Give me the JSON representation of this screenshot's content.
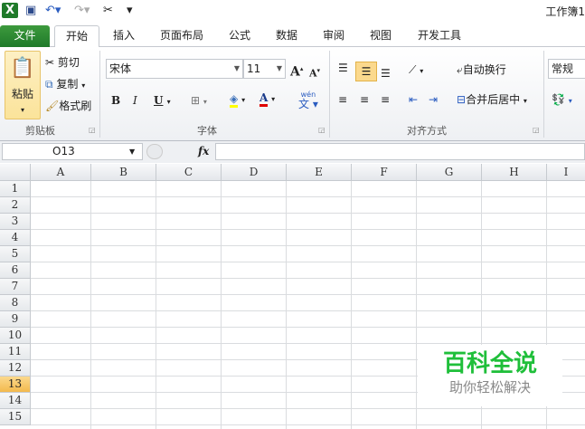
{
  "qat": {
    "app_icon": "excel-icon",
    "save": "save-icon",
    "undo": "undo-icon",
    "redo": "redo-icon",
    "tools": "tools-icon",
    "customize": "customize-qat-icon"
  },
  "title": "工作簿1",
  "tabs": [
    "文件",
    "开始",
    "插入",
    "页面布局",
    "公式",
    "数据",
    "审阅",
    "视图",
    "开发工具"
  ],
  "active_tab": "开始",
  "ribbon": {
    "clipboard": {
      "paste": "粘贴",
      "cut": "剪切",
      "copy": "复制",
      "format_painter": "格式刷",
      "label": "剪贴板"
    },
    "font": {
      "name": "宋体",
      "size": "11",
      "bold": "B",
      "italic": "I",
      "underline": "U",
      "font_color": "A",
      "phonetic": "wén",
      "label": "字体"
    },
    "alignment": {
      "wrap": "自动换行",
      "merge": "合并后居中",
      "label": "对齐方式"
    },
    "number": {
      "format": "常规"
    }
  },
  "formula_bar": {
    "name_box": "O13",
    "fx": "fx",
    "value": ""
  },
  "grid": {
    "columns": [
      "A",
      "B",
      "C",
      "D",
      "E",
      "F",
      "G",
      "H",
      "I"
    ],
    "rows": [
      "1",
      "2",
      "3",
      "4",
      "5",
      "6",
      "7",
      "8",
      "9",
      "10",
      "11",
      "12",
      "13",
      "14",
      "15"
    ],
    "selected_row": "13"
  },
  "watermark": {
    "title": "百科全说",
    "subtitle": "助你轻松解决",
    "color": "#1fbf3a"
  },
  "colors": {
    "file_tab": "#2a8a34",
    "selected_header": "#f6c461",
    "highlight_yellow": "#ffff00",
    "font_red": "#e00000"
  }
}
